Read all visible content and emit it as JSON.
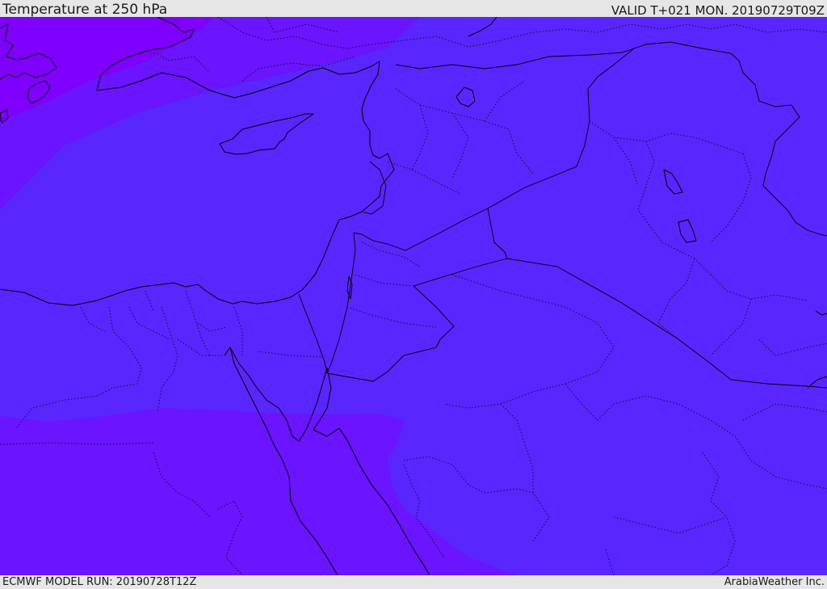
{
  "header": {
    "title": "Temperature at 250 hPa",
    "valid": "VALID T+021 MON. 20190729T09Z"
  },
  "footer": {
    "model_run": "ECMWF MODEL RUN: 20190728T12Z",
    "credit": "ArabiaWeather Inc."
  },
  "map": {
    "variable": "temperature",
    "level": "250 hPa",
    "colors": {
      "coldest_zone": "#7f00ff",
      "cold_zone": "#6a14ff",
      "main_zone": "#5a26ff",
      "coastline": "#000000"
    }
  }
}
